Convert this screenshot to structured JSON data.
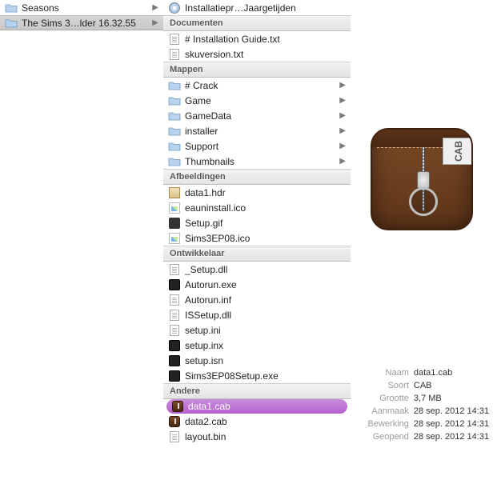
{
  "col1": {
    "items": [
      {
        "label": "Seasons",
        "selected": false
      },
      {
        "label": "The Sims 3…lder 16.32.55",
        "selected": true
      }
    ]
  },
  "col2": {
    "top": [
      {
        "label": "Installatiepr…Jaargetijden",
        "iconClass": "disc-ico",
        "hasArrow": false
      }
    ],
    "sections": [
      {
        "title": "Documenten",
        "items": [
          {
            "label": "# Installation Guide.txt",
            "iconClass": "page-ico"
          },
          {
            "label": "skuversion.txt",
            "iconClass": "page-ico"
          }
        ]
      },
      {
        "title": "Mappen",
        "items": [
          {
            "label": "# Crack",
            "iconClass": "folder",
            "hasArrow": true
          },
          {
            "label": "Game",
            "iconClass": "folder",
            "hasArrow": true
          },
          {
            "label": "GameData",
            "iconClass": "folder",
            "hasArrow": true
          },
          {
            "label": "installer",
            "iconClass": "folder",
            "hasArrow": true
          },
          {
            "label": "Support",
            "iconClass": "folder",
            "hasArrow": true
          },
          {
            "label": "Thumbnails",
            "iconClass": "folder",
            "hasArrow": true
          }
        ]
      },
      {
        "title": "Afbeeldingen",
        "items": [
          {
            "label": "data1.hdr",
            "iconClass": "box-ico"
          },
          {
            "label": "eauninstall.ico",
            "iconClass": "img-ico"
          },
          {
            "label": "Setup.gif",
            "iconClass": "gif-ico"
          },
          {
            "label": "Sims3EP08.ico",
            "iconClass": "img-ico"
          }
        ]
      },
      {
        "title": "Ontwikkelaar",
        "items": [
          {
            "label": "_Setup.dll",
            "iconClass": "page-ico"
          },
          {
            "label": "Autorun.exe",
            "iconClass": "exe-ico"
          },
          {
            "label": "Autorun.inf",
            "iconClass": "page-ico"
          },
          {
            "label": "ISSetup.dll",
            "iconClass": "page-ico"
          },
          {
            "label": "setup.ini",
            "iconClass": "page-ico"
          },
          {
            "label": "setup.inx",
            "iconClass": "exe-ico"
          },
          {
            "label": "setup.isn",
            "iconClass": "exe-ico"
          },
          {
            "label": "Sims3EP08Setup.exe",
            "iconClass": "exe-ico"
          }
        ]
      },
      {
        "title": "Andere",
        "items": [
          {
            "label": "data1.cab",
            "iconClass": "cab-small",
            "selected": true
          },
          {
            "label": "data2.cab",
            "iconClass": "cab-small"
          },
          {
            "label": "layout.bin",
            "iconClass": "page-ico"
          }
        ]
      }
    ]
  },
  "preview": {
    "tag": "CAB",
    "meta": {
      "naam_k": "Naam",
      "naam_v": "data1.cab",
      "soort_k": "Soort",
      "soort_v": "CAB",
      "grootte_k": "Grootte",
      "grootte_v": "3,7 MB",
      "aanmaak_k": "Aanmaak",
      "aanmaak_v": "28 sep. 2012 14:31",
      "bewerking_k": "Bewerking",
      "bewerking_v": "28 sep. 2012 14:31",
      "geopend_k": "Geopend",
      "geopend_v": "28 sep. 2012 14:31"
    }
  }
}
